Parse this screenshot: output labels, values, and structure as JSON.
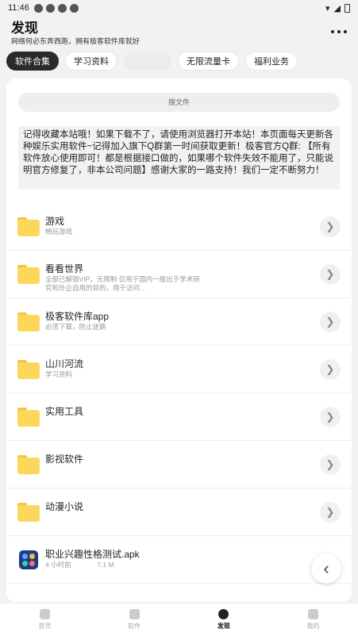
{
  "status_bar": {
    "time": "11:46"
  },
  "header": {
    "title": "发现",
    "subtitle": "网络何必东奔西跑，拥有极客软件库就好"
  },
  "tabs": [
    {
      "label": "软件合集"
    },
    {
      "label": "学习资料"
    },
    {
      "label": ""
    },
    {
      "label": "无限流量卡"
    },
    {
      "label": "福利业务"
    }
  ],
  "search": {
    "placeholder": "搜文件"
  },
  "notice": {
    "text": "记得收藏本站哦！如果下载不了，请使用浏览器打开本站！本页面每天更新各种娱乐实用软件~记得加入旗下Q群第一时间获取更新！极客官方Q群: 【所有软件放心使用即可！都是根据接口做的，如果哪个软件失效不能用了，只能说明官方修复了，非本公司问题】感谢大家的一路支持！我们一定不断努力！"
  },
  "items": [
    {
      "title": "游戏",
      "desc": "畅玩游戏"
    },
    {
      "title": "看看世界",
      "desc": "全部已解锁VIP，无限制 仅用于国内一般出于学术研究和外企自用的目的，用于访问..."
    },
    {
      "title": "极客软件库app",
      "desc": "必须下载，防止迷路"
    },
    {
      "title": "山川河流",
      "desc": "学习资料"
    },
    {
      "title": "实用工具",
      "desc": ""
    },
    {
      "title": "影视软件",
      "desc": ""
    },
    {
      "title": "动漫小说",
      "desc": ""
    }
  ],
  "apk_item": {
    "title": "职业兴趣性格测试.apk",
    "time": "4 小时前",
    "size": "7.1 M"
  },
  "bottom_nav": [
    {
      "label": "首页"
    },
    {
      "label": "软件"
    },
    {
      "label": "发现"
    },
    {
      "label": "我的"
    }
  ]
}
